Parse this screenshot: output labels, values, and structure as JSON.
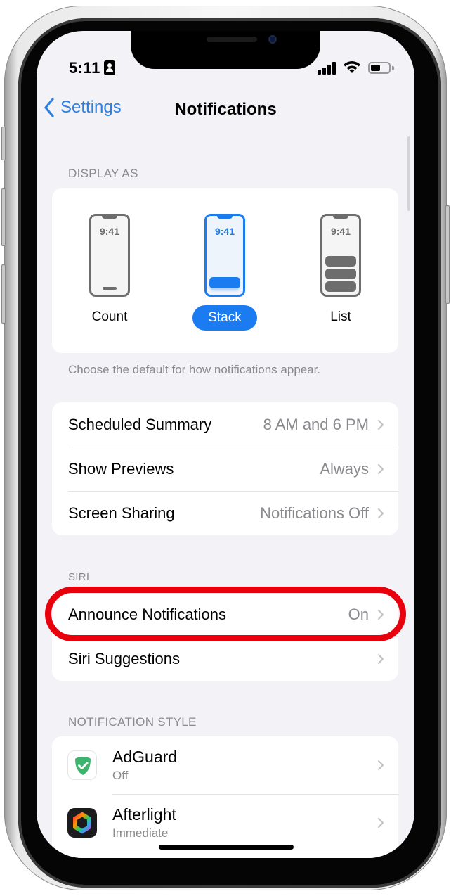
{
  "status_bar": {
    "time": "5:11",
    "focus_icon": "contact-card-icon",
    "signal_icon": "cellular-signal-icon",
    "wifi_icon": "wifi-icon",
    "battery_icon": "battery-icon"
  },
  "nav": {
    "back_label": "Settings",
    "back_icon": "chevron-left-icon",
    "title": "Notifications"
  },
  "display_as": {
    "header": "DISPLAY AS",
    "options": [
      {
        "label": "Count",
        "time": "9:41",
        "selected": false
      },
      {
        "label": "Stack",
        "time": "9:41",
        "selected": true
      },
      {
        "label": "List",
        "time": "9:41",
        "selected": false
      }
    ],
    "footer": "Choose the default for how notifications appear."
  },
  "general_rows": [
    {
      "label": "Scheduled Summary",
      "value": "8 AM and 6 PM"
    },
    {
      "label": "Show Previews",
      "value": "Always"
    },
    {
      "label": "Screen Sharing",
      "value": "Notifications Off"
    }
  ],
  "siri": {
    "header": "SIRI",
    "rows": [
      {
        "label": "Announce Notifications",
        "value": "On",
        "highlighted": true
      },
      {
        "label": "Siri Suggestions",
        "value": ""
      }
    ]
  },
  "notification_style": {
    "header": "NOTIFICATION STYLE",
    "apps": [
      {
        "name": "AdGuard",
        "status": "Off",
        "icon": "adguard-shield-icon"
      },
      {
        "name": "Afterlight",
        "status": "Immediate",
        "icon": "afterlight-aperture-icon"
      }
    ]
  },
  "colors": {
    "accent": "#1a7cf0",
    "link": "#2f7fe0",
    "highlight": "#e8000c",
    "background": "#f2f2f7",
    "secondary_text": "#8a8a8e"
  }
}
